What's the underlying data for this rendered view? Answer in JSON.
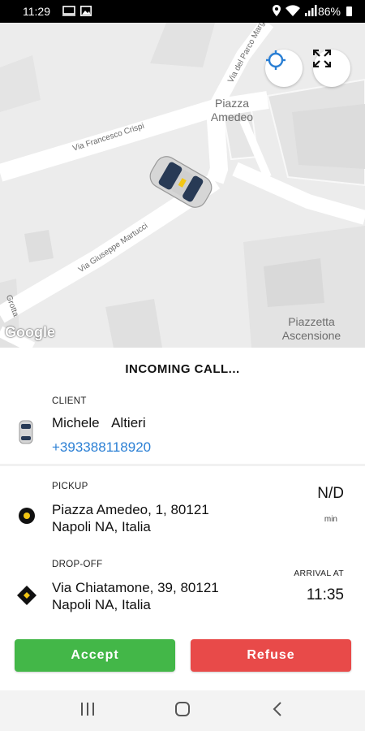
{
  "status_bar": {
    "time": "11:29",
    "battery": "86%",
    "icons": [
      "cast-icon",
      "image-icon",
      "location-icon",
      "wifi-icon",
      "signal-icon",
      "battery-icon"
    ]
  },
  "map": {
    "place_labels": {
      "piazza_amedeo": "Piazza\nAmedeo",
      "piazzetta_ascensione": "Piazzetta\nAscensione"
    },
    "street_labels": {
      "francesco_crispi": "Via Francesco Crispi",
      "giuseppe_martucci": "Via Giuseppe Martucci",
      "parco_margherita": "Via del Parco Margherita",
      "grotta": "Grotta"
    },
    "attribution": "Google",
    "buttons": [
      "locate-icon",
      "fullscreen-icon"
    ]
  },
  "sheet": {
    "title": "INCOMING CALL...",
    "client": {
      "label": "CLIENT",
      "name": "Michele  Altieri",
      "phone": "+393388118920"
    },
    "pickup": {
      "label": "PICKUP",
      "address": "Piazza Amedeo, 1, 80121\nNapoli NA, Italia",
      "eta_value": "N/D",
      "eta_unit": "min"
    },
    "dropoff": {
      "label": "DROP-OFF",
      "address": "Via Chiatamone, 39, 80121\nNapoli NA, Italia",
      "arrival_label": "ARRIVAL AT",
      "arrival_time": "11:35"
    },
    "accept_label": "Accept",
    "refuse_label": "Refuse",
    "colors": {
      "accept": "#43b748",
      "refuse": "#e84a49",
      "phone": "#2a7fd4",
      "marker": "#f3c614"
    }
  },
  "nav_bar": {
    "items": [
      "recent-apps-icon",
      "home-icon",
      "back-icon"
    ]
  }
}
